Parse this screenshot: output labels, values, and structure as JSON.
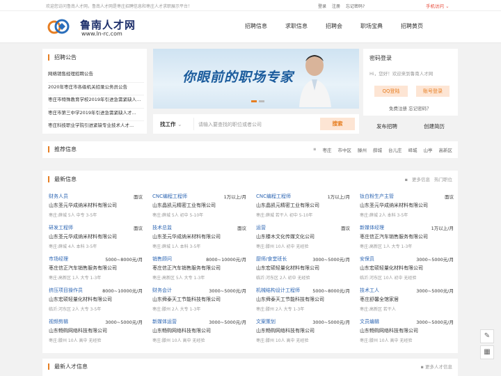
{
  "topbar": {
    "welcome": "欢迎您访问鲁南人才网，鲁南人才网是枣庄招聘信息和枣庄人才求职展示平台！",
    "login": "登录",
    "register": "注册",
    "forgot": "忘记密码?",
    "mobile": "手机访问"
  },
  "header": {
    "logo_name": "鲁南人才网",
    "logo_url": "www.ln-rc.com",
    "nav": [
      "招聘信息",
      "求职信息",
      "招聘会",
      "职场宝典",
      "招聘黄页"
    ]
  },
  "notice": {
    "title": "招聘公告",
    "items": [
      "网络销售经理招聘公告",
      "2020年枣庄市各级机关招录公务员公告",
      "枣庄市特殊教育学校2019年引进急需紧缺人才...",
      "枣庄市第三中学2019年引进急需紧缺人才...",
      "枣庄科技职业学院引进紧缺专业技术人才..."
    ]
  },
  "banner": {
    "slogan": "你眼前的职场专家"
  },
  "search": {
    "category": "找工作",
    "placeholder": "请输入要查找的职位或者公司",
    "button": "搜索"
  },
  "login": {
    "title": "密码登录",
    "greeting": "Hi，您好！欢迎来到鲁南人才网",
    "qq": "QQ登陆",
    "account": "账号登录",
    "free_register": "免费注册",
    "forgot": "忘记密码？",
    "post_job": "发布招聘",
    "create_resume": "创建简历"
  },
  "recommend": {
    "title": "推荐信息",
    "areas": [
      "枣庄",
      "市中区",
      "滕州",
      "薛城",
      "台儿庄",
      "峄城",
      "山亭",
      "高新区"
    ]
  },
  "latest": {
    "title": "最新信息",
    "more": "更多信息",
    "hot": "热门职位",
    "jobs": [
      {
        "title": "财务人员",
        "salary": "面议",
        "company": "山东圣元华成纳米材料有限公司",
        "meta": "枣庄:薛城  5人  中专  3-5年"
      },
      {
        "title": "CNC编程工程师",
        "salary": "1万以上/月",
        "company": "山东晶凯元精密工业有限公司",
        "meta": "枣庄:薛城  5人  初中  5-10年"
      },
      {
        "title": "CNC编程工程师",
        "salary": "1万以上/月",
        "company": "山东晶凯元精密工业有限公司",
        "meta": "枣庄:薛城  若干人  初中  5-10年"
      },
      {
        "title": "钛白粉生产主管",
        "salary": "面议",
        "company": "山东圣元华成纳米材料有限公司",
        "meta": "枣庄:薛城  2人  本科  3-5年"
      },
      {
        "title": "研发工程师",
        "salary": "面议",
        "company": "山东圣元华成纳米材料有限公司",
        "meta": "枣庄:薛城  4人  本科  3-5年"
      },
      {
        "title": "技术总监",
        "salary": "面议",
        "company": "山东圣元华成纳米材料有限公司",
        "meta": "枣庄:薛城  1人  本科  3-5年"
      },
      {
        "title": "运营",
        "salary": "面议",
        "company": "山东楼木文化传媒文化公司",
        "meta": "枣庄:滕州  10人  初中  无经验"
      },
      {
        "title": "新媒体经理",
        "salary": "1万以上/月",
        "company": "枣庄信正汽车销售服务有限公司",
        "meta": "枣庄:高新区  1人  大专  1-3年"
      },
      {
        "title": "市场经理",
        "salary": "5000~8000元/月",
        "company": "枣庄信正汽车销售服务有限公司",
        "meta": "枣庄:高新区  1人  大专  1-3年"
      },
      {
        "title": "销售顾问",
        "salary": "8000~10000元/月",
        "company": "枣庄信正汽车销售服务有限公司",
        "meta": "枣庄:高新区  5人  大专  1-3年"
      },
      {
        "title": "厨师/食堂班长",
        "salary": "3000~5000元/月",
        "company": "山东宏硕轻量化材料有限公司",
        "meta": "临沂:河东区  2人  初中  无经验"
      },
      {
        "title": "安保员",
        "salary": "3000~5000元/月",
        "company": "山东宏硕轻量化材料有限公司",
        "meta": "临沂:河东区  10人  初中  无经验"
      },
      {
        "title": "挤压项目操作员",
        "salary": "8000~10000元/月",
        "company": "山东宏硕轻量化材料有限公司",
        "meta": "临沂:河东区  2人  大专  3-5年"
      },
      {
        "title": "财务会计",
        "salary": "3000~5000元/月",
        "company": "山东舜泰天工节能科技有限公司",
        "meta": "枣庄:滕州  2人  大专  1-3年"
      },
      {
        "title": "机械结构设计工程师",
        "salary": "5000~8000元/月",
        "company": "山东舜泰天工节能科技有限公司",
        "meta": "枣庄:滕州  2人  大专  1-3年"
      },
      {
        "title": "技术工人",
        "salary": "3000~5000元/月",
        "company": "枣庄舒馨全馆家居",
        "meta": "枣庄:高新区  若干人"
      },
      {
        "title": "视频剪辑",
        "salary": "3000~5000元/月",
        "company": "山东畅购网络科技有限公司",
        "meta": "枣庄:滕州  10人  高中  无经验"
      },
      {
        "title": "新媒体运营",
        "salary": "3000~5000元/月",
        "company": "山东畅购网络科技有限公司",
        "meta": "枣庄:滕州  10人  高中  无经验"
      },
      {
        "title": "文案策划",
        "salary": "3000~5000元/月",
        "company": "山东畅购网络科技有限公司",
        "meta": "枣庄:滕州  10人  高中  无经验"
      },
      {
        "title": "文员编辑",
        "salary": "3000~5000元/月",
        "company": "山东畅购网络科技有限公司",
        "meta": "枣庄:滕州  10人  高中  无经验"
      }
    ]
  },
  "talent": {
    "title": "最新人才信息",
    "more": "更多人才信息"
  },
  "tools": [
    "pencil-icon",
    "qrcode-icon"
  ],
  "colors": {
    "accent": "#e67e22",
    "link": "#2d66b3",
    "brand": "#1d2f6b"
  }
}
